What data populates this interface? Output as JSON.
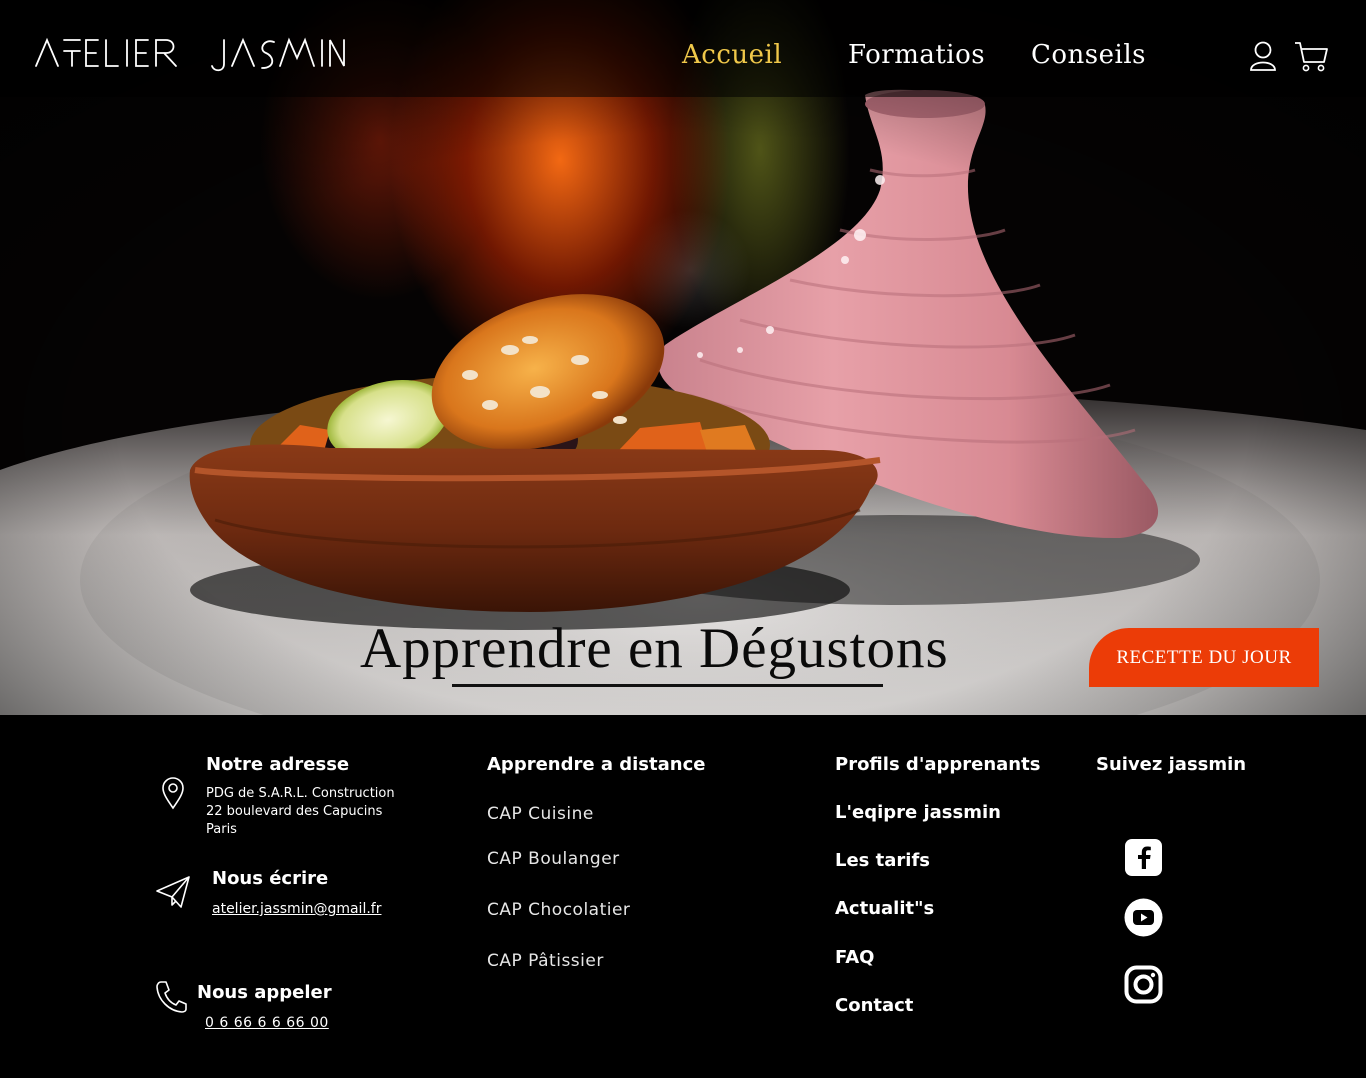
{
  "brand": {
    "logo_text": "ATELIER JASMIN"
  },
  "nav": {
    "items": [
      {
        "label": "Accueil",
        "active": true
      },
      {
        "label": "Formatios",
        "active": false
      },
      {
        "label": "Conseils",
        "active": false
      }
    ],
    "icons": [
      "user-icon",
      "cart-icon"
    ],
    "active_color": "#f0c84a"
  },
  "hero": {
    "tagline": "Apprendre en Dégustons",
    "button_label": "RECETTE DU JOUR",
    "button_color": "#ec3c07"
  },
  "footer": {
    "address": {
      "title": "Notre adresse",
      "lines": [
        "PDG de S.A.R.L. Construction",
        "22 boulevard des Capucins",
        "Paris"
      ],
      "icon": "location-pin-icon"
    },
    "write": {
      "title": "Nous écrire",
      "email": "atelier.jassmin@gmail.fr",
      "icon": "paper-plane-icon"
    },
    "call": {
      "title": "Nous appeler",
      "phone": "0 6 66 6 6 66 00",
      "icon": "phone-icon"
    },
    "distance": {
      "title": "Apprendre a distance",
      "links": [
        "CAP Cuisine",
        "CAP Boulanger",
        "CAP Chocolatier",
        "CAP Pâtissier"
      ]
    },
    "info_links": [
      "Profils d'apprenants",
      "L'eqipre jassmin",
      "Les tarifs",
      "Actualit\"s",
      "FAQ",
      "Contact"
    ],
    "social": {
      "title": "Suivez jassmin",
      "icons": [
        "facebook-icon",
        "youtube-icon",
        "instagram-icon"
      ]
    }
  }
}
